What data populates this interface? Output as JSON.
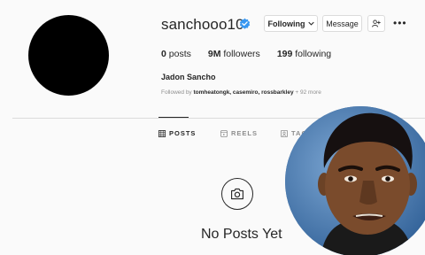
{
  "profile": {
    "username": "sanchooo10",
    "full_name": "Jadon Sancho",
    "followed_by_prefix": "Followed by ",
    "followed_by_names": "tomheatongk, casemiro, rossbarkley",
    "followed_by_more": " + 92 more"
  },
  "actions": {
    "following_label": "Following",
    "message_label": "Message"
  },
  "stats": {
    "posts_count": "0",
    "posts_label": " posts",
    "followers_count": "9M",
    "followers_label": " followers",
    "following_count": "199",
    "following_label": " following"
  },
  "tabs": [
    {
      "label": "POSTS",
      "icon": "grid-icon",
      "active": true
    },
    {
      "label": "REELS",
      "icon": "reels-icon",
      "active": false
    },
    {
      "label": "TAG",
      "icon": "tag-icon",
      "active": false
    }
  ],
  "empty_state": {
    "message": "No Posts Yet",
    "icon": "camera-icon"
  },
  "colors": {
    "verified": "#3897f0",
    "text": "#262626",
    "muted": "#8e8e8e",
    "border": "#dbdbdb",
    "avatar": "#000000"
  }
}
